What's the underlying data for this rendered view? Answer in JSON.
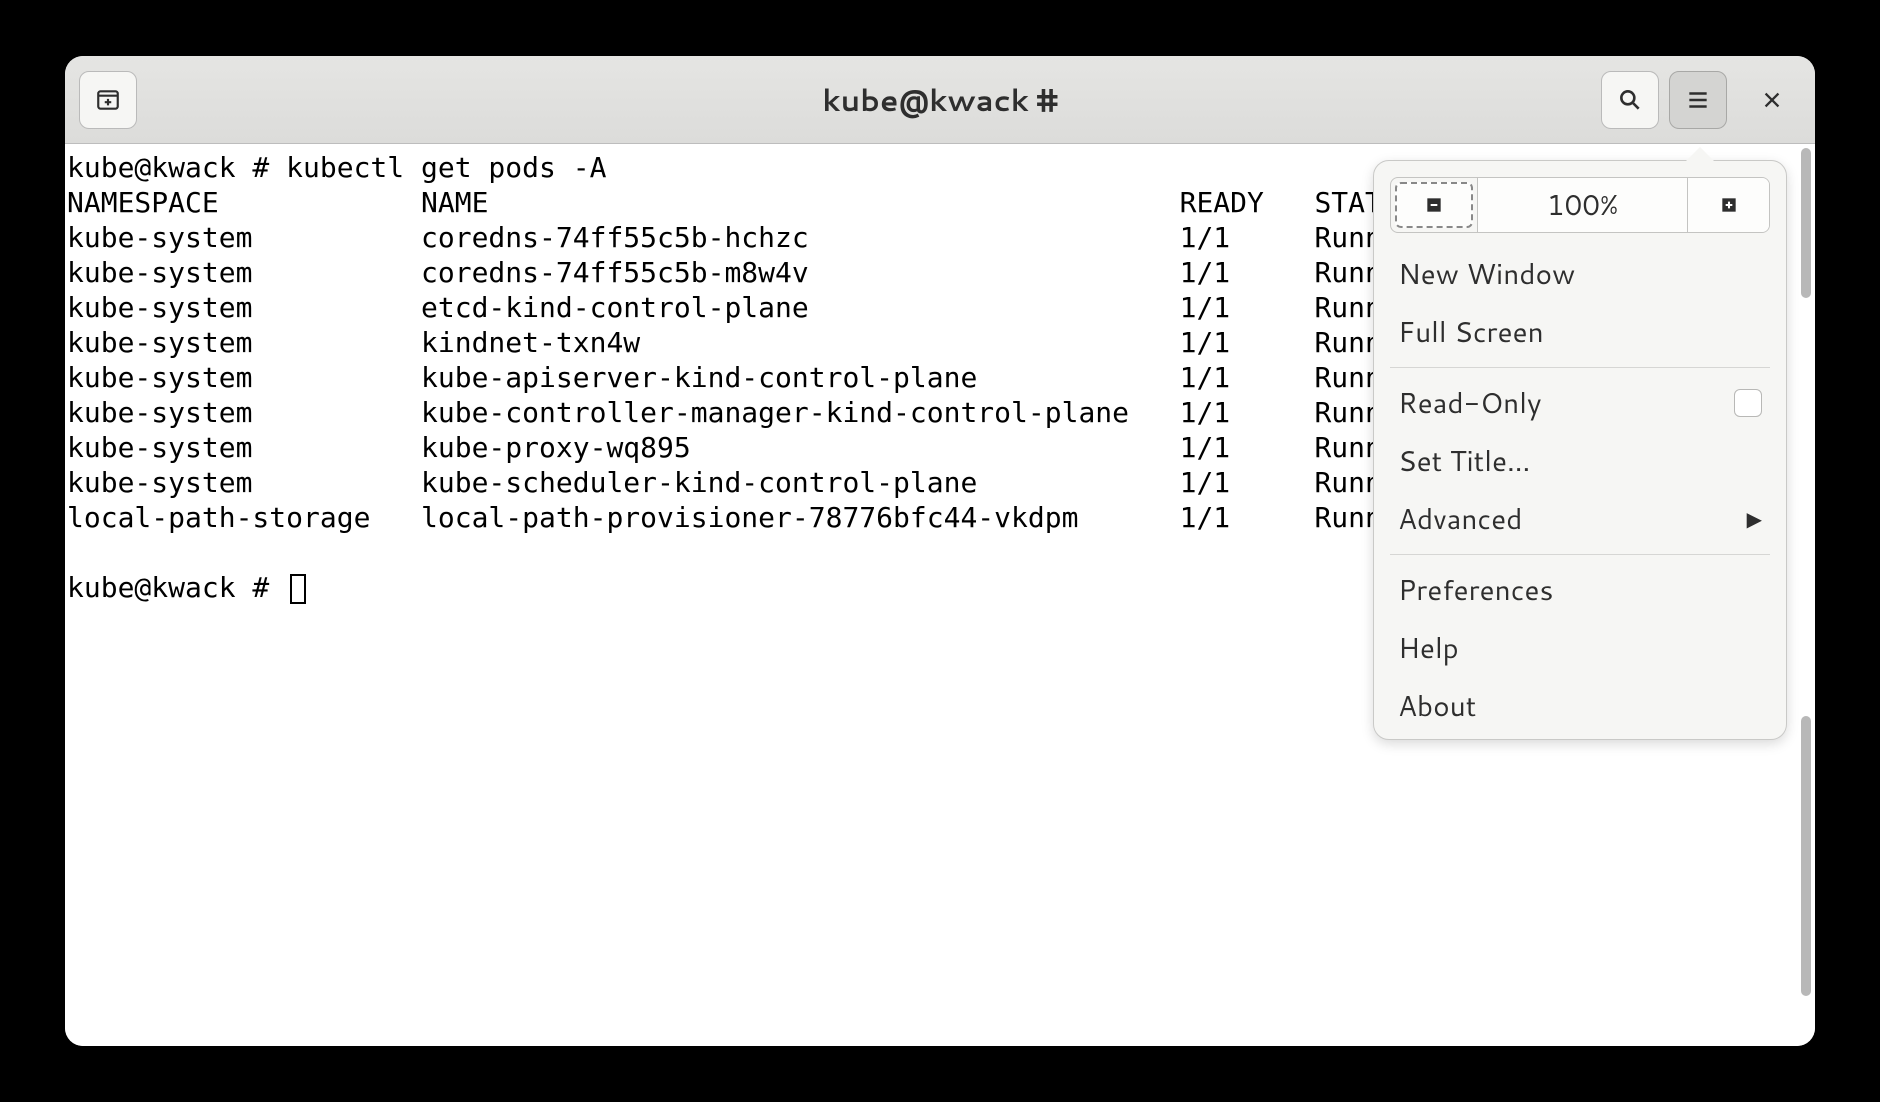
{
  "titlebar": {
    "title": "kube@kwack #"
  },
  "terminal": {
    "prompt1": "kube@kwack # kubectl get pods -A",
    "header": {
      "namespace": "NAMESPACE",
      "name": "NAME",
      "ready": "READY",
      "status": "STATUS"
    },
    "rows": [
      {
        "namespace": "kube-system",
        "name": "coredns-74ff55c5b-hchzc",
        "ready": "1/1",
        "status": "Running"
      },
      {
        "namespace": "kube-system",
        "name": "coredns-74ff55c5b-m8w4v",
        "ready": "1/1",
        "status": "Running"
      },
      {
        "namespace": "kube-system",
        "name": "etcd-kind-control-plane",
        "ready": "1/1",
        "status": "Running"
      },
      {
        "namespace": "kube-system",
        "name": "kindnet-txn4w",
        "ready": "1/1",
        "status": "Running"
      },
      {
        "namespace": "kube-system",
        "name": "kube-apiserver-kind-control-plane",
        "ready": "1/1",
        "status": "Running"
      },
      {
        "namespace": "kube-system",
        "name": "kube-controller-manager-kind-control-plane",
        "ready": "1/1",
        "status": "Running"
      },
      {
        "namespace": "kube-system",
        "name": "kube-proxy-wq895",
        "ready": "1/1",
        "status": "Running"
      },
      {
        "namespace": "kube-system",
        "name": "kube-scheduler-kind-control-plane",
        "ready": "1/1",
        "status": "Running"
      },
      {
        "namespace": "local-path-storage",
        "name": "local-path-provisioner-78776bfc44-vkdpm",
        "ready": "1/1",
        "status": "Running"
      }
    ],
    "prompt2": "kube@kwack # "
  },
  "menu": {
    "zoom_level": "100%",
    "new_window": "New Window",
    "full_screen": "Full Screen",
    "read_only": "Read-Only",
    "set_title": "Set Title…",
    "advanced": "Advanced",
    "preferences": "Preferences",
    "help": "Help",
    "about": "About"
  }
}
